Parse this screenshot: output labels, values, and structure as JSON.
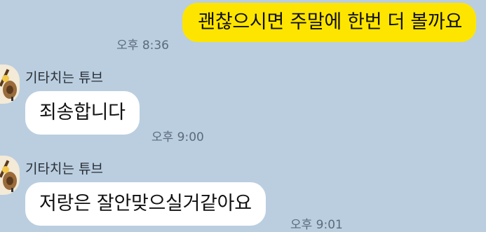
{
  "messages": [
    {
      "direction": "outgoing",
      "text": "괜찮으시면 주말에 한번 더 볼까요",
      "time": "오후 8:36"
    },
    {
      "direction": "incoming",
      "sender": "기타치는 튜브",
      "avatar_icon": "tube-guitar-avatar-icon",
      "text": "죄송합니다",
      "time": "오후 9:00"
    },
    {
      "direction": "incoming",
      "sender": "기타치는 튜브",
      "avatar_icon": "tube-guitar-avatar-icon",
      "text": "저랑은 잘안맞으실거같아요",
      "time": "오후 9:01"
    }
  ],
  "colors": {
    "background": "#bacee0",
    "outgoing_bubble": "#fee500",
    "incoming_bubble": "#ffffff",
    "timestamp": "#5b6b7a"
  }
}
